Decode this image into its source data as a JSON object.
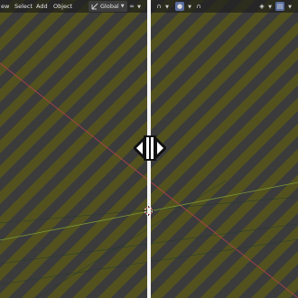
{
  "header": {
    "menu": {
      "view": "ew",
      "select": "Select",
      "add": "Add",
      "object": "Object"
    },
    "orientation": {
      "value": "Global"
    }
  },
  "icons": {
    "orientation": "global-orientation-icon",
    "dropdown": "chevron-down-icon",
    "pivot": "pivot-point-icon",
    "snap": "snap-magnet-icon",
    "proportional": "proportional-edit-icon",
    "visibility": "visibility-icon",
    "gizmo": "gizmo-icon",
    "area_resize": "area-split-resize-icon",
    "cursor3d": "3d-cursor-icon"
  },
  "colors": {
    "stripe_dark": "#3b3b3b",
    "stripe_olive": "#53521f",
    "x_axis": "#b4424e",
    "y_axis": "#7b9a31",
    "splitter": "#f4f4f4",
    "selected_button": "#5a6e9e"
  }
}
